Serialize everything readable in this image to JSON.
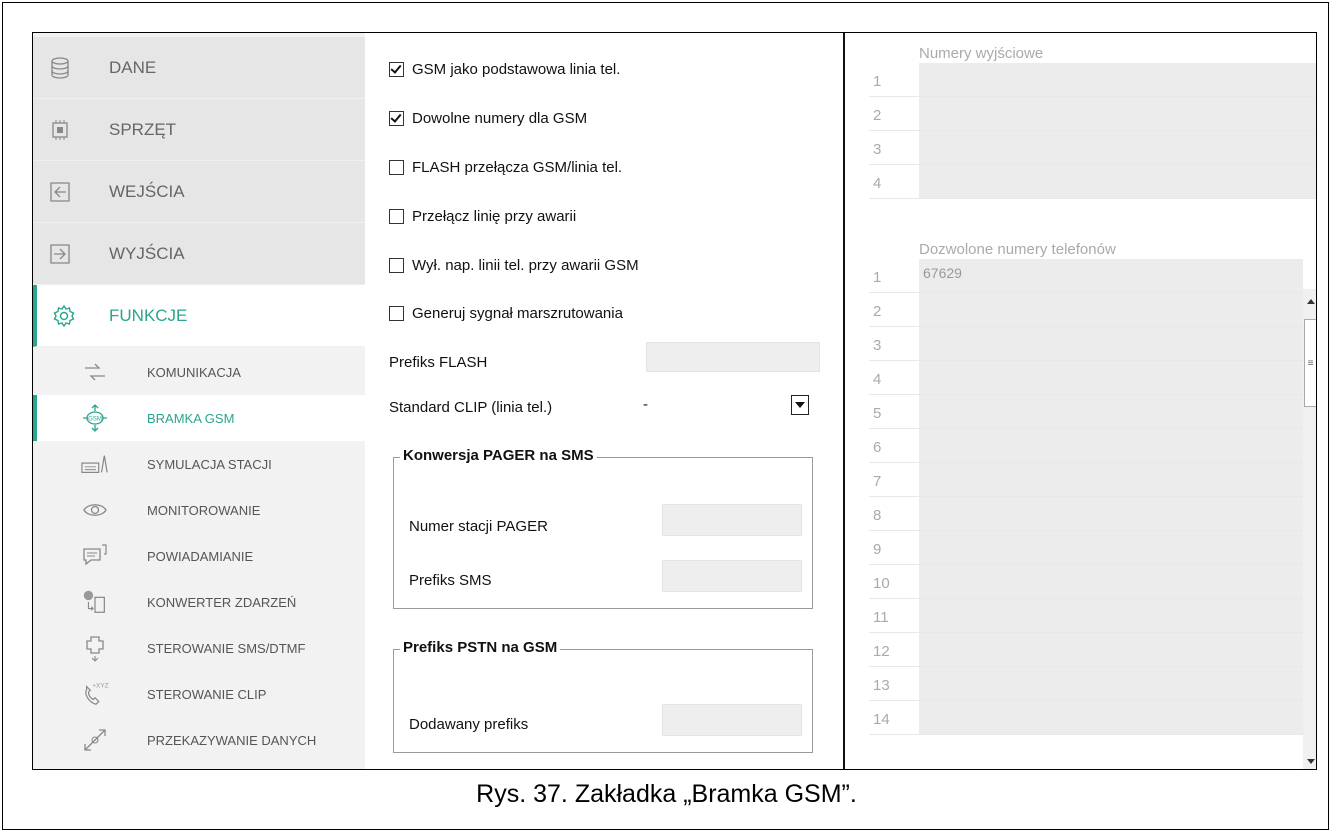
{
  "sidebar": {
    "main": [
      {
        "label": "DANE",
        "icon": "database-icon"
      },
      {
        "label": "SPRZĘT",
        "icon": "chip-icon"
      },
      {
        "label": "WEJŚCIA",
        "icon": "input-arrow-icon"
      },
      {
        "label": "WYJŚCIA",
        "icon": "output-arrow-icon"
      },
      {
        "label": "FUNKCJE",
        "icon": "gear-icon",
        "active": true
      }
    ],
    "sub": [
      {
        "label": "KOMUNIKACJA",
        "icon": "exchange-arrows-icon"
      },
      {
        "label": "BRAMKA GSM",
        "icon": "gsm-gateway-icon",
        "active": true
      },
      {
        "label": "SYMULACJA STACJI",
        "icon": "station-simulation-icon"
      },
      {
        "label": "MONITOROWANIE",
        "icon": "eye-icon"
      },
      {
        "label": "POWIADAMIANIE",
        "icon": "message-icon"
      },
      {
        "label": "KONWERTER ZDARZEŃ",
        "icon": "event-converter-icon"
      },
      {
        "label": "STEROWANIE SMS/DTMF",
        "icon": "control-puzzle-icon"
      },
      {
        "label": "STEROWANIE CLIP",
        "icon": "clip-phone-icon"
      },
      {
        "label": "PRZEKAZYWANIE DANYCH",
        "icon": "data-transfer-icon"
      }
    ]
  },
  "options": [
    {
      "label": "GSM jako podstawowa linia tel.",
      "checked": true
    },
    {
      "label": "Dowolne numery dla GSM",
      "checked": true
    },
    {
      "label": "FLASH przełącza GSM/linia tel.",
      "checked": false
    },
    {
      "label": "Przełącz linię przy awarii",
      "checked": false
    },
    {
      "label": "Wył. nap. linii tel. przy awarii GSM",
      "checked": false
    },
    {
      "label": "Generuj sygnał marszrutowania",
      "checked": false
    }
  ],
  "form": {
    "flash_prefix_label": "Prefiks FLASH",
    "flash_prefix_value": "",
    "clip_label": "Standard CLIP (linia tel.)",
    "clip_value": "-",
    "pager_group_title": "Konwersja PAGER na SMS",
    "pager_station_label": "Numer stacji PAGER",
    "sms_prefix_label": "Prefiks SMS",
    "pstn_group_title": "Prefiks PSTN na GSM",
    "added_prefix_label": "Dodawany prefiks"
  },
  "output_numbers": {
    "title": "Numery wyjściowe",
    "rows": [
      {
        "n": "1",
        "value": ""
      },
      {
        "n": "2",
        "value": ""
      },
      {
        "n": "3",
        "value": ""
      },
      {
        "n": "4",
        "value": ""
      }
    ]
  },
  "allowed_numbers": {
    "title": "Dozwolone numery telefonów",
    "rows": [
      {
        "n": "1",
        "value": "67629"
      },
      {
        "n": "2",
        "value": ""
      },
      {
        "n": "3",
        "value": ""
      },
      {
        "n": "4",
        "value": ""
      },
      {
        "n": "5",
        "value": ""
      },
      {
        "n": "6",
        "value": ""
      },
      {
        "n": "7",
        "value": ""
      },
      {
        "n": "8",
        "value": ""
      },
      {
        "n": "9",
        "value": ""
      },
      {
        "n": "10",
        "value": ""
      },
      {
        "n": "11",
        "value": ""
      },
      {
        "n": "12",
        "value": ""
      },
      {
        "n": "13",
        "value": ""
      },
      {
        "n": "14",
        "value": ""
      }
    ]
  },
  "caption": "Rys. 37. Zakładka „Bramka GSM”.",
  "colors": {
    "accent": "#2aa58f"
  }
}
